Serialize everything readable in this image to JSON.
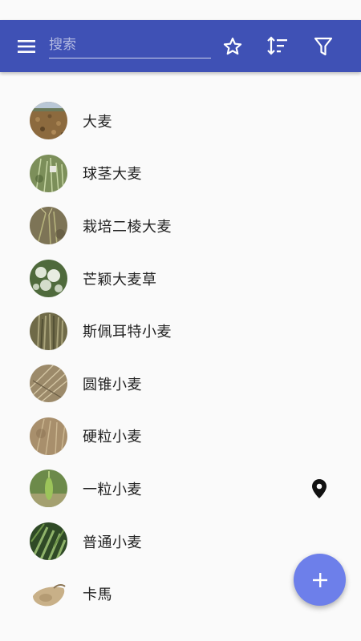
{
  "toolbar": {
    "search_placeholder": "搜索",
    "icons": [
      "menu-icon",
      "star-outline-icon",
      "sort-icon",
      "filter-icon"
    ],
    "color": "#3f51b5"
  },
  "plants": [
    {
      "name": "大麦",
      "thumb": "barley-field",
      "has_location": false
    },
    {
      "name": "球茎大麦",
      "thumb": "bulbous-barley",
      "has_location": false
    },
    {
      "name": "栽培二棱大麦",
      "thumb": "two-row-barley",
      "has_location": false
    },
    {
      "name": "芒颖大麦草",
      "thumb": "foxtail-barley",
      "has_location": false
    },
    {
      "name": "斯佩耳特小麦",
      "thumb": "spelt",
      "has_location": false
    },
    {
      "name": "圆锥小麦",
      "thumb": "poulard-wheat",
      "has_location": false
    },
    {
      "name": "硬粒小麦",
      "thumb": "durum-wheat",
      "has_location": false
    },
    {
      "name": "一粒小麦",
      "thumb": "einkorn",
      "has_location": true
    },
    {
      "name": "普通小麦",
      "thumb": "common-wheat",
      "has_location": false
    },
    {
      "name": "卡馬",
      "thumb": "kamut",
      "has_location": false
    }
  ],
  "fab": {
    "icon": "plus-icon",
    "color": "#6d7fea"
  }
}
